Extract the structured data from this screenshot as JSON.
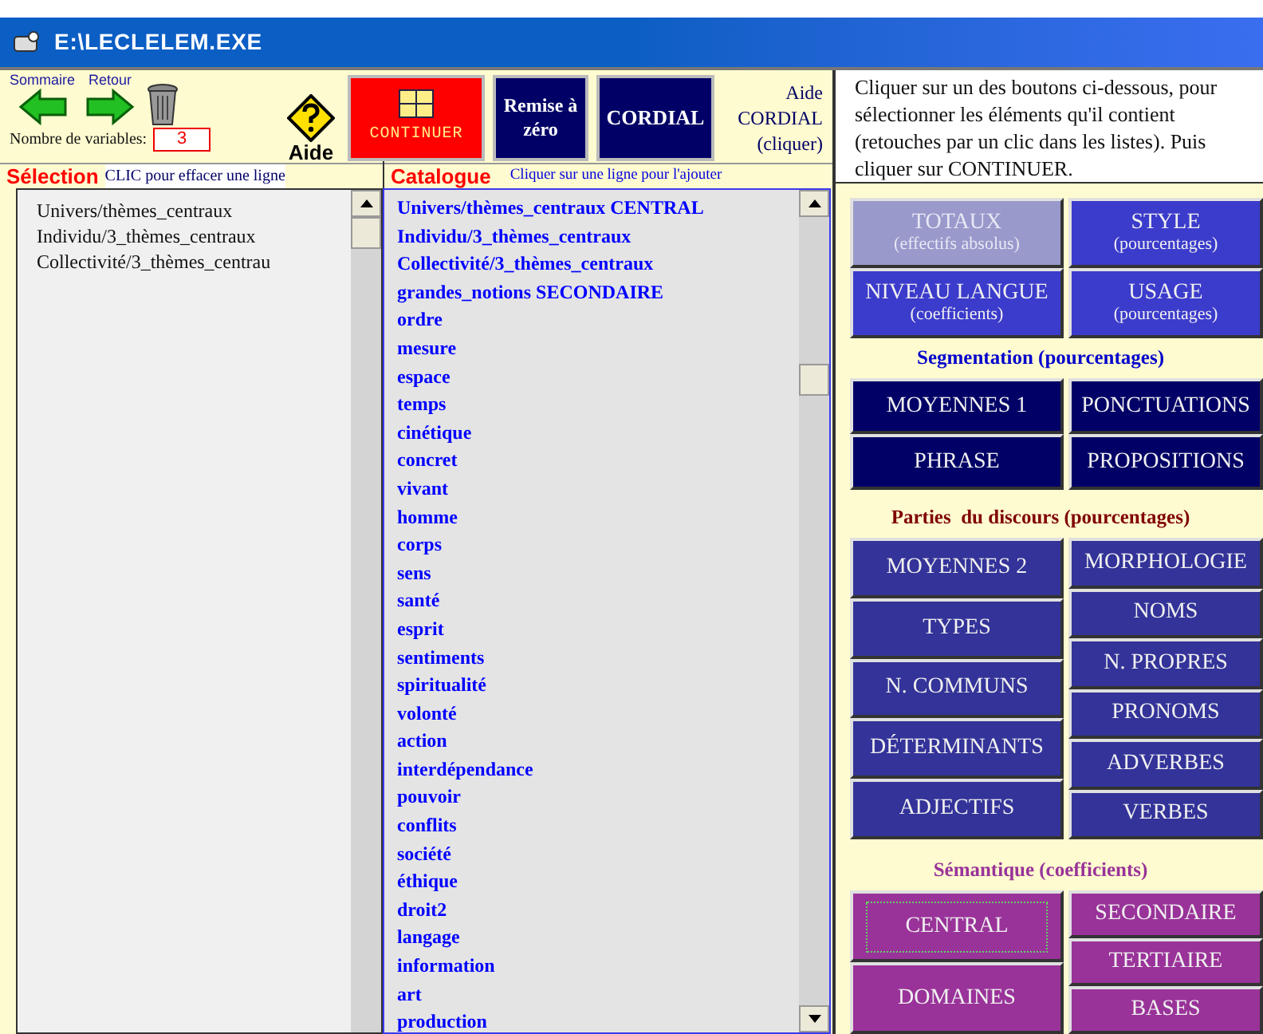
{
  "window": {
    "title": "E:\\LECLELEM.EXE"
  },
  "toolbar": {
    "nav_buttons": [
      {
        "label": "Sommaire",
        "kind": "back"
      },
      {
        "label": "Retour",
        "kind": "forward"
      }
    ],
    "variables_label": "Nombre de variables:",
    "variables_value": "3",
    "help_label": "Aide",
    "continue_button": "CONTINUER",
    "reset_button": "Remise à zéro",
    "cordial_button": "CORDIAL",
    "cordial_help": [
      "Aide",
      "CORDIAL",
      "(cliquer)"
    ]
  },
  "selection": {
    "title": "Sélection",
    "hint": "CLIC pour effacer une ligne",
    "items": [
      "Univers/thèmes_centraux",
      "Individu/3_thèmes_centraux",
      "Collectivité/3_thèmes_centrau"
    ]
  },
  "catalogue": {
    "title": "Catalogue",
    "hint": "Cliquer sur une ligne pour l'ajouter",
    "items": [
      "Univers/thèmes_centraux CENTRAL",
      "Individu/3_thèmes_centraux",
      "Collectivité/3_thèmes_centraux",
      "grandes_notions SECONDAIRE",
      "ordre",
      "mesure",
      "espace",
      "temps",
      "cinétique",
      "concret",
      "vivant",
      "homme",
      "corps",
      "sens",
      "santé",
      "esprit",
      "sentiments",
      "spiritualité",
      "volonté",
      "action",
      "interdépendance",
      "pouvoir",
      "conflits",
      "société",
      "éthique",
      "droit2",
      "langage",
      "information",
      "art",
      "production"
    ]
  },
  "instructions": "Cliquer sur un des boutons ci-dessous, pour sélectionner les éléments qu'il contient (retouches par un clic dans les listes). Puis cliquer sur CONTINUER.",
  "button_groups": [
    {
      "kind": "totals",
      "left": [
        {
          "label": "TOTAUX",
          "sublabel": "(effectifs absolus)",
          "disabled": true,
          "focused": false
        },
        {
          "label": "NIVEAU LANGUE",
          "sublabel": "(coefficients)",
          "disabled": false,
          "focused": false
        }
      ],
      "right": [
        {
          "label": "STYLE",
          "sublabel": "(pourcentages)",
          "disabled": false,
          "focused": false
        },
        {
          "label": "USAGE",
          "sublabel": "(pourcentages)",
          "disabled": false,
          "focused": false
        }
      ]
    },
    {
      "heading": "Segmentation (pourcentages)",
      "kind": "segmentation",
      "left": [
        {
          "label": "MOYENNES 1",
          "disabled": false,
          "focused": false
        },
        {
          "label": "PHRASE",
          "disabled": false,
          "focused": false
        }
      ],
      "right": [
        {
          "label": "PONCTUATIONS",
          "disabled": false,
          "focused": false
        },
        {
          "label": "PROPOSITIONS",
          "disabled": false,
          "focused": false
        }
      ]
    },
    {
      "heading": "Parties  du discours (pourcentages)",
      "kind": "parts",
      "left": [
        {
          "label": "MOYENNES 2",
          "disabled": false,
          "focused": false
        },
        {
          "label": "TYPES",
          "disabled": false,
          "focused": false
        },
        {
          "label": "N. COMMUNS",
          "disabled": false,
          "focused": false
        },
        {
          "label": "DÉTERMINANTS",
          "disabled": false,
          "focused": false
        },
        {
          "label": "ADJECTIFS",
          "disabled": false,
          "focused": false
        }
      ],
      "right": [
        {
          "label": "MORPHOLOGIE",
          "disabled": false,
          "focused": false
        },
        {
          "label": "NOMS",
          "disabled": false,
          "focused": false
        },
        {
          "label": "N. PROPRES",
          "disabled": false,
          "focused": false
        },
        {
          "label": "PRONOMS",
          "disabled": false,
          "focused": false
        },
        {
          "label": "ADVERBES",
          "disabled": false,
          "focused": false
        },
        {
          "label": "VERBES",
          "disabled": false,
          "focused": false
        }
      ]
    },
    {
      "heading": "Sémantique (coefficients)",
      "kind": "semantics",
      "left": [
        {
          "label": "CENTRAL",
          "disabled": false,
          "focused": true
        },
        {
          "label": "DOMAINES",
          "disabled": false,
          "focused": false
        }
      ],
      "right": [
        {
          "label": "SECONDAIRE",
          "disabled": false,
          "focused": false
        },
        {
          "label": "TERTIAIRE",
          "disabled": false,
          "focused": false
        },
        {
          "label": "BASES",
          "disabled": false,
          "focused": false
        }
      ]
    }
  ]
}
